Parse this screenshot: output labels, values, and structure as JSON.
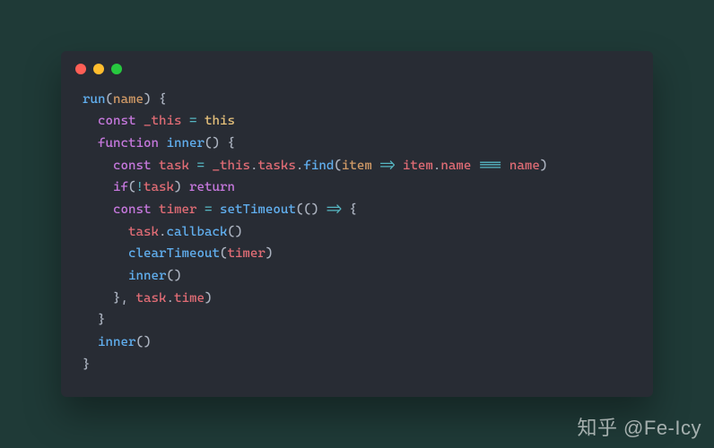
{
  "window": {
    "dots": {
      "red": "#ff5f56",
      "yellow": "#ffbd2e",
      "green": "#27c93f"
    }
  },
  "code": {
    "l1_run": "run",
    "l1_name": "name",
    "l2_const": "const",
    "l2_this_var": "_this",
    "l2_eq": " = ",
    "l2_this": "this",
    "l3_function": "function",
    "l3_inner": "inner",
    "l4_const": "const",
    "l4_task": "task",
    "l4_eq": " = ",
    "l4_thisv": "_this",
    "l4_tasks": "tasks",
    "l4_find": "find",
    "l4_item": "item",
    "l4_arrow": " => ",
    "l4_item2": "item",
    "l4_nameprop": "name",
    "l4_eqeq": " === ",
    "l4_namep": "name",
    "l5_if": "if",
    "l5_bang": "!",
    "l5_task": "task",
    "l5_return": "return",
    "l6_const": "const",
    "l6_timer": "timer",
    "l6_eq": " = ",
    "l6_set": "setTimeout",
    "l6_arrow": " => ",
    "l7_task": "task",
    "l7_cb": "callback",
    "l8_clear": "clearTimeout",
    "l8_timer": "timer",
    "l9_inner": "inner",
    "l10_task": "task",
    "l10_time": "time",
    "l12_inner": "inner"
  },
  "watermark": "知乎 @Fe-Icy"
}
